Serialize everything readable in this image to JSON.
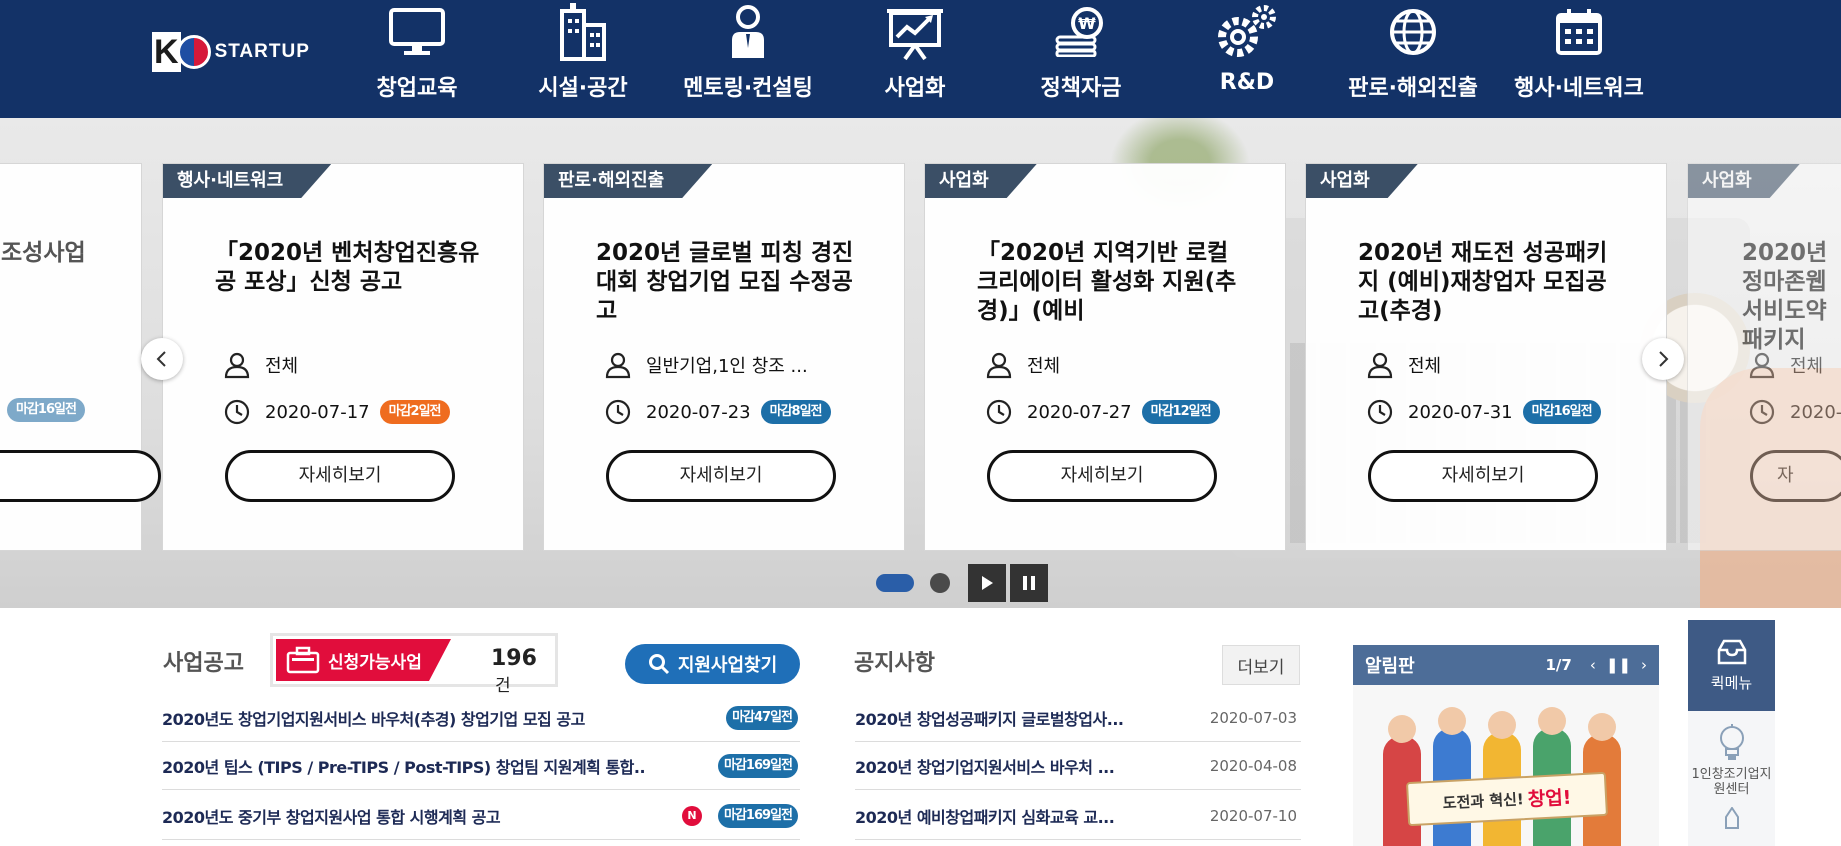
{
  "logo": {
    "k": "K",
    "text": "STARTUP"
  },
  "nav": [
    {
      "label": "창업교육",
      "icon": "monitor-icon"
    },
    {
      "label": "시설·공간",
      "icon": "building-icon"
    },
    {
      "label": "멘토링·컨설팅",
      "icon": "mentor-person-icon"
    },
    {
      "label": "사업화",
      "icon": "presentation-chart-icon"
    },
    {
      "label": "정책자금",
      "icon": "coins-icon"
    },
    {
      "label": "R&D",
      "icon": "gears-icon"
    },
    {
      "label": "판로·해외진출",
      "icon": "globe-icon"
    },
    {
      "label": "행사·네트워크",
      "icon": "calendar-icon"
    }
  ],
  "slider": {
    "partial_left": {
      "title": "조성사업",
      "badge": "마감16일전"
    },
    "cards": [
      {
        "tag": "행사·네트워크",
        "title": "「2020년 벤처창업진흥유공 포상」신청 공고",
        "target": "전체",
        "date": "2020-07-17",
        "badge": "마감2일전",
        "badge_color": "orange",
        "button": "자세히보기"
      },
      {
        "tag": "판로·해외진출",
        "title": "2020년 글로벌 피칭 경진대회 창업기업 모집 수정공고",
        "target": "일반기업,1인 창조 ...",
        "date": "2020-07-23",
        "badge": "마감8일전",
        "badge_color": "blue",
        "button": "자세히보기"
      },
      {
        "tag": "사업화",
        "title": "「2020년 지역기반 로컬크리에이터 활성화 지원(추경)」(예비",
        "target": "전체",
        "date": "2020-07-27",
        "badge": "마감12일전",
        "badge_color": "blue",
        "button": "자세히보기"
      },
      {
        "tag": "사업화",
        "title": "2020년 재도전 성공패키지 (예비)재창업자 모집공고(추경)",
        "target": "전체",
        "date": "2020-07-31",
        "badge": "마감16일전",
        "badge_color": "blue",
        "button": "자세히보기"
      }
    ],
    "partial_right": {
      "tag": "사업화",
      "title": "2020년 정마존웹서비도약패키지",
      "target": "전체",
      "date": "2020-0",
      "button": "자"
    }
  },
  "business": {
    "title": "사업공고",
    "avail_label": "신청가능사업",
    "avail_count": "196",
    "avail_unit": "건",
    "find_button": "지원사업찾기",
    "items": [
      {
        "text": "2020년도 창업기업지원서비스 바우처(추경) 창업기업 모집 공고",
        "deadline": "마감47일전",
        "new": ""
      },
      {
        "text": "2020년 팁스 (TIPS / Pre-TIPS / Post-TIPS) 창업팀 지원계획 통합..",
        "deadline": "마감169일전",
        "new": ""
      },
      {
        "text": "2020년도 중기부 창업지원사업 통합 시행계획 공고",
        "deadline": "마감169일전",
        "new": "N"
      }
    ]
  },
  "notice": {
    "title": "공지사항",
    "more": "더보기",
    "items": [
      {
        "text": "2020년 창업성공패키지 글로벌창업사...",
        "date": "2020-07-03"
      },
      {
        "text": "2020년 창업기업지원서비스 바우처 ...",
        "date": "2020-04-08"
      },
      {
        "text": "2020년 예비창업패키지 심화교육 교...",
        "date": "2020-07-10"
      }
    ]
  },
  "board": {
    "title": "알림판",
    "page": "1/7",
    "prev": "‹",
    "pause": "❚❚",
    "next": "›",
    "banner": "도전과 혁신!",
    "banner_em": "창업!"
  },
  "quick": {
    "menu_label": "퀵메뉴",
    "item1": "1인창조기업지원센터"
  },
  "colors": {
    "header": "#133267",
    "accent_red": "#e10d3c",
    "accent_blue": "#1f6fb8",
    "orange": "#ef6c1f"
  }
}
